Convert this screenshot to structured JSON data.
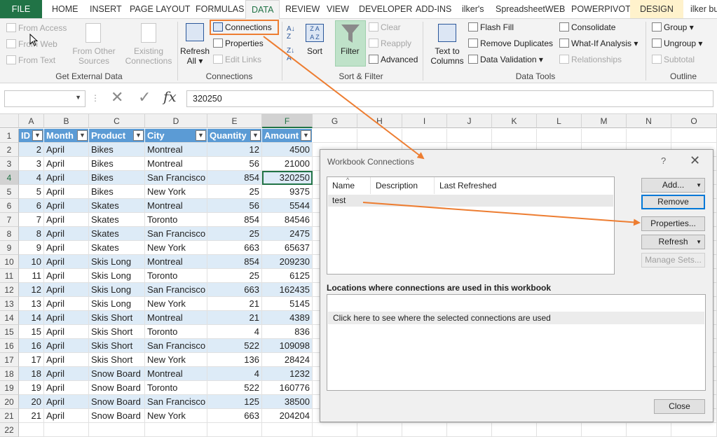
{
  "tabs": [
    "FILE",
    "HOME",
    "INSERT",
    "PAGE LAYOUT",
    "FORMULAS",
    "DATA",
    "REVIEW",
    "VIEW",
    "DEVELOPER",
    "ADD-INS",
    "ilker's",
    "SpreadsheetWEB",
    "POWERPIVOT",
    "DESIGN",
    "ilker bu"
  ],
  "ribbon": {
    "get_external": {
      "from_access": "From Access",
      "from_web": "From Web",
      "from_text": "From Text",
      "from_other_1": "From Other",
      "from_other_2": "Sources",
      "existing_1": "Existing",
      "existing_2": "Connections",
      "label": "Get External Data"
    },
    "connections": {
      "refresh_1": "Refresh",
      "refresh_2": "All",
      "connections": "Connections",
      "properties": "Properties",
      "edit_links": "Edit Links",
      "label": "Connections"
    },
    "sort_filter": {
      "sort": "Sort",
      "filter": "Filter",
      "clear": "Clear",
      "reapply": "Reapply",
      "advanced": "Advanced",
      "label": "Sort & Filter"
    },
    "data_tools": {
      "text_to_1": "Text to",
      "text_to_2": "Columns",
      "flash_fill": "Flash Fill",
      "remove_duplicates": "Remove Duplicates",
      "data_validation": "Data Validation",
      "consolidate": "Consolidate",
      "what_if": "What-If Analysis",
      "relationships": "Relationships",
      "label": "Data Tools"
    },
    "outline": {
      "group": "Group",
      "ungroup": "Ungroup",
      "subtotal": "Subtotal",
      "label": "Outline"
    }
  },
  "formula": {
    "namebox": "",
    "value": "320250"
  },
  "columns": [
    "A",
    "B",
    "C",
    "D",
    "E",
    "F",
    "G",
    "H",
    "I",
    "J",
    "K",
    "L",
    "M",
    "N",
    "O"
  ],
  "table": {
    "headers": [
      "ID",
      "Month",
      "Product",
      "City",
      "Quantity",
      "Amount"
    ],
    "rows": [
      [
        "2",
        "April",
        "Bikes",
        "Montreal",
        "12",
        "4500"
      ],
      [
        "3",
        "April",
        "Bikes",
        "Montreal",
        "56",
        "21000"
      ],
      [
        "4",
        "April",
        "Bikes",
        "San Francisco",
        "854",
        "320250"
      ],
      [
        "5",
        "April",
        "Bikes",
        "New York",
        "25",
        "9375"
      ],
      [
        "6",
        "April",
        "Skates",
        "Montreal",
        "56",
        "5544"
      ],
      [
        "7",
        "April",
        "Skates",
        "Toronto",
        "854",
        "84546"
      ],
      [
        "8",
        "April",
        "Skates",
        "San Francisco",
        "25",
        "2475"
      ],
      [
        "9",
        "April",
        "Skates",
        "New York",
        "663",
        "65637"
      ],
      [
        "10",
        "April",
        "Skis Long",
        "Montreal",
        "854",
        "209230"
      ],
      [
        "11",
        "April",
        "Skis Long",
        "Toronto",
        "25",
        "6125"
      ],
      [
        "12",
        "April",
        "Skis Long",
        "San Francisco",
        "663",
        "162435"
      ],
      [
        "13",
        "April",
        "Skis Long",
        "New York",
        "21",
        "5145"
      ],
      [
        "14",
        "April",
        "Skis Short",
        "Montreal",
        "21",
        "4389"
      ],
      [
        "15",
        "April",
        "Skis Short",
        "Toronto",
        "4",
        "836"
      ],
      [
        "16",
        "April",
        "Skis Short",
        "San Francisco",
        "522",
        "109098"
      ],
      [
        "17",
        "April",
        "Skis Short",
        "New York",
        "136",
        "28424"
      ],
      [
        "18",
        "April",
        "Snow Board",
        "Montreal",
        "4",
        "1232"
      ],
      [
        "19",
        "April",
        "Snow Board",
        "Toronto",
        "522",
        "160776"
      ],
      [
        "20",
        "April",
        "Snow Board",
        "San Francisco",
        "125",
        "38500"
      ],
      [
        "21",
        "April",
        "Snow Board",
        "New York",
        "663",
        "204204"
      ]
    ]
  },
  "dialog": {
    "title": "Workbook Connections",
    "help": "?",
    "close_x": "✕",
    "col_name": "Name",
    "col_description": "Description",
    "col_last_refreshed": "Last Refreshed",
    "connection_name": "test",
    "btn_add": "Add...",
    "btn_remove": "Remove",
    "btn_properties": "Properties...",
    "btn_refresh": "Refresh",
    "btn_manage_sets": "Manage Sets...",
    "locations_label": "Locations where connections are used in this workbook",
    "locations_hint": "Click here to see where the selected connections are used",
    "btn_close": "Close"
  },
  "colors": {
    "excel_green": "#217346",
    "table_header": "#5b9bd5",
    "table_band": "#ddebf7",
    "annotation_orange": "#ed7d31"
  }
}
